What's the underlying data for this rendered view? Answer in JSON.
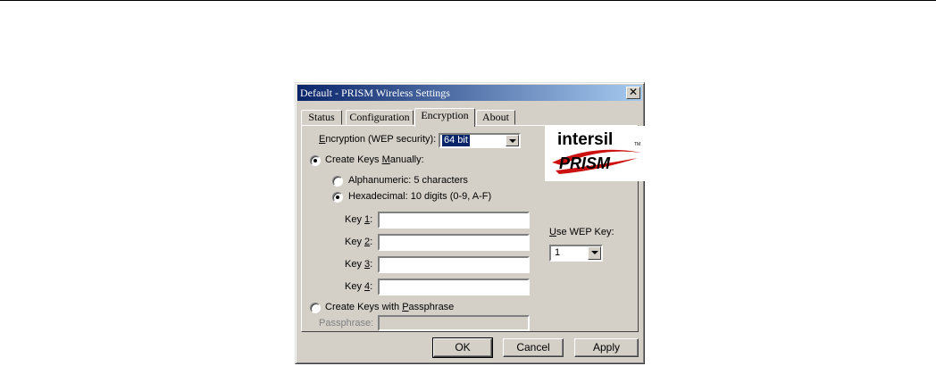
{
  "window": {
    "title": "Default - PRISM  Wireless Settings",
    "close_glyph": "✕"
  },
  "tabs": [
    {
      "label": "Status",
      "active": false
    },
    {
      "label": "Configuration",
      "active": false
    },
    {
      "label": "Encryption",
      "active": true
    },
    {
      "label": "About",
      "active": false
    }
  ],
  "encryption": {
    "label_prefix": "E",
    "label_rest": "ncryption (WEP security):",
    "selected": "64 bit"
  },
  "manual": {
    "prefix": "Create Keys ",
    "accel": "M",
    "suffix": "anually:",
    "checked": true
  },
  "alphanumeric": {
    "label": "Alphanumeric: 5 characters",
    "checked": false
  },
  "hexadecimal": {
    "label": "Hexadecimal: 10 digits (0-9, A-F)",
    "checked": true
  },
  "keys": [
    {
      "prefix": "Key ",
      "accel": "1",
      "suffix": ":",
      "value": ""
    },
    {
      "prefix": "Key ",
      "accel": "2",
      "suffix": ":",
      "value": ""
    },
    {
      "prefix": "Key ",
      "accel": "3",
      "suffix": ":",
      "value": ""
    },
    {
      "prefix": "Key ",
      "accel": "4",
      "suffix": ":",
      "value": ""
    }
  ],
  "use_wep_key": {
    "accel": "U",
    "rest": "se WEP Key:",
    "selected": "1"
  },
  "passphrase_mode": {
    "prefix": "Create Keys with ",
    "accel": "P",
    "suffix": "assphrase",
    "checked": false
  },
  "passphrase": {
    "label": "Passphrase:",
    "value": ""
  },
  "logo": {
    "brand1": "intersil",
    "tm": "TM",
    "brand2": "PRISM"
  },
  "buttons": {
    "ok": "OK",
    "cancel": "Cancel",
    "apply": "Apply"
  },
  "colors": {
    "titlebar_start": "#0a246a",
    "titlebar_end": "#a6caf0",
    "logo_red": "#cc1111",
    "face": "#d4d0c8"
  }
}
